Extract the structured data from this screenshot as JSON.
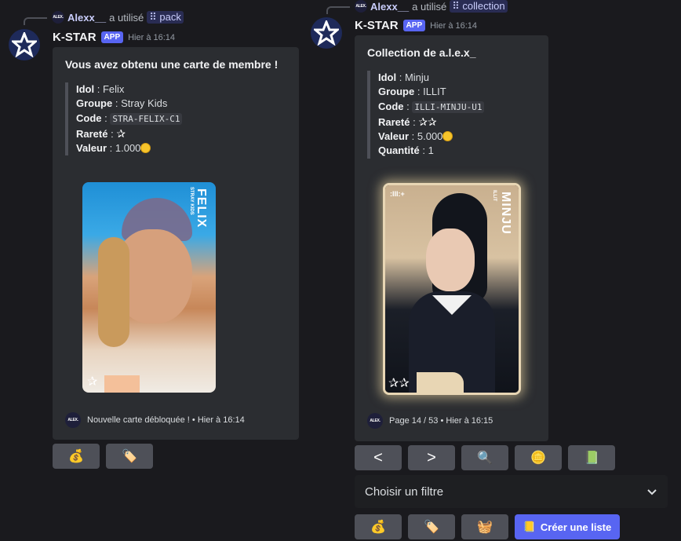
{
  "left": {
    "reply": {
      "user": "Alexx__",
      "action": "a utilisé",
      "command": "pack",
      "mini_avatar": "ALEX."
    },
    "header": {
      "bot": "K-STAR",
      "badge": "APP",
      "time": "Hier à 16:14"
    },
    "embed": {
      "title": "Vous avez obtenu une carte de membre !",
      "fields": [
        {
          "label": "Idol",
          "value": "Felix"
        },
        {
          "label": "Groupe",
          "value": "Stray Kids"
        },
        {
          "label": "Code",
          "value": "STRA-FELIX-C1"
        },
        {
          "label": "Rareté",
          "value": ""
        },
        {
          "label": "Valeur",
          "value": "1.000"
        }
      ],
      "card": {
        "name": "FELIX",
        "group": "STRAY KIDS"
      },
      "footer": {
        "text": "Nouvelle carte débloquée ! • Hier à 16:14",
        "avatar": "ALEX."
      }
    },
    "buttons": [
      {
        "icon": "money-bag-icon",
        "glyph": "💰"
      },
      {
        "icon": "tag-icon",
        "glyph": "🏷️"
      }
    ]
  },
  "right": {
    "reply": {
      "user": "Alexx__",
      "action": "a utilisé",
      "command": "collection",
      "mini_avatar": "ALEX."
    },
    "header": {
      "bot": "K-STAR",
      "badge": "APP",
      "time": "Hier à 16:14"
    },
    "embed": {
      "title": "Collection de a.l.e.x_",
      "fields": [
        {
          "label": "Idol",
          "value": "Minju"
        },
        {
          "label": "Groupe",
          "value": "ILLIT"
        },
        {
          "label": "Code",
          "value": "ILLI-MINJU-U1"
        },
        {
          "label": "Rareté",
          "value": ""
        },
        {
          "label": "Valeur",
          "value": "5.000"
        },
        {
          "label": "Quantité",
          "value": "1"
        }
      ],
      "card": {
        "name": "MINJU",
        "group": "ILLIT",
        "logo": ":III:+"
      },
      "footer": {
        "text": "Page 14 / 53 • Hier à 16:15",
        "avatar": "ALEX."
      }
    },
    "nav_buttons": [
      {
        "icon": "prev-arrow-icon",
        "glyph": "<"
      },
      {
        "icon": "next-arrow-icon",
        "glyph": ">"
      },
      {
        "icon": "magnifier-icon",
        "glyph": "🔍"
      },
      {
        "icon": "coins-icon",
        "glyph": "🪙"
      },
      {
        "icon": "spreadsheet-icon",
        "glyph": "📗"
      }
    ],
    "select": {
      "placeholder": "Choisir un filtre"
    },
    "bottom_buttons": [
      {
        "icon": "money-bag-icon",
        "glyph": "💰"
      },
      {
        "icon": "tag-icon",
        "glyph": "🏷️"
      },
      {
        "icon": "basket-icon",
        "glyph": "🧺"
      }
    ],
    "create_list": {
      "icon": "notepad-icon",
      "glyph": "📒",
      "label": "Créer une liste"
    }
  },
  "colors": {
    "accent": "#5865f2",
    "background": "#1a1a1e",
    "embed": "#2b2d31",
    "button": "#4e5058"
  }
}
